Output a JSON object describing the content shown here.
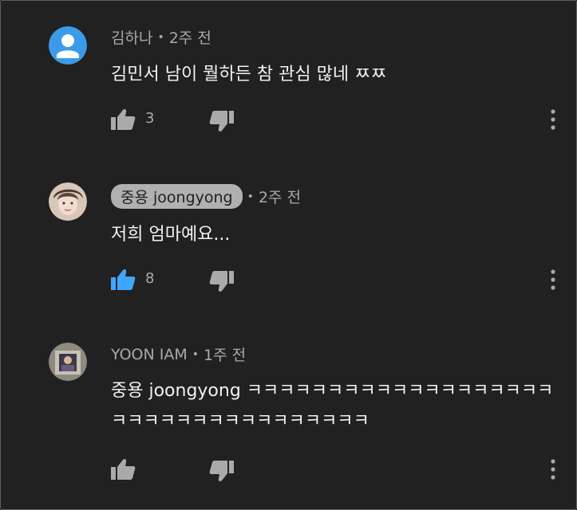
{
  "comments": [
    {
      "author": "김하나",
      "time": "2주 전",
      "text": "김민서 남이 뭘하든 참 관심 많네 ㅉㅉ",
      "likes": "3",
      "liked": false,
      "avatar_icon": "default-person-icon"
    },
    {
      "author": "중용 joongyong",
      "time": "2주 전",
      "text": "저희 엄마예요...",
      "likes": "8",
      "liked": true,
      "avatar_icon": "profile-photo"
    },
    {
      "author": "YOON IAM",
      "time": "1주 전",
      "text_line1": "중용 joongyong ㅋㅋㅋㅋㅋㅋㅋㅋㅋㅋㅋㅋㅋㅋㅋㅋㅋㅋㅋ",
      "text_line2": "ㅋㅋㅋㅋㅋㅋㅋㅋㅋㅋㅋㅋㅋㅋㅋㅋ",
      "likes": "",
      "avatar_icon": "profile-photo"
    }
  ],
  "separator": "•",
  "colors": {
    "background": "#212121",
    "text": "#f1f1f1",
    "secondary": "#aaaaaa",
    "like_active": "#3ea6ff",
    "default_avatar": "#3c9be8"
  }
}
